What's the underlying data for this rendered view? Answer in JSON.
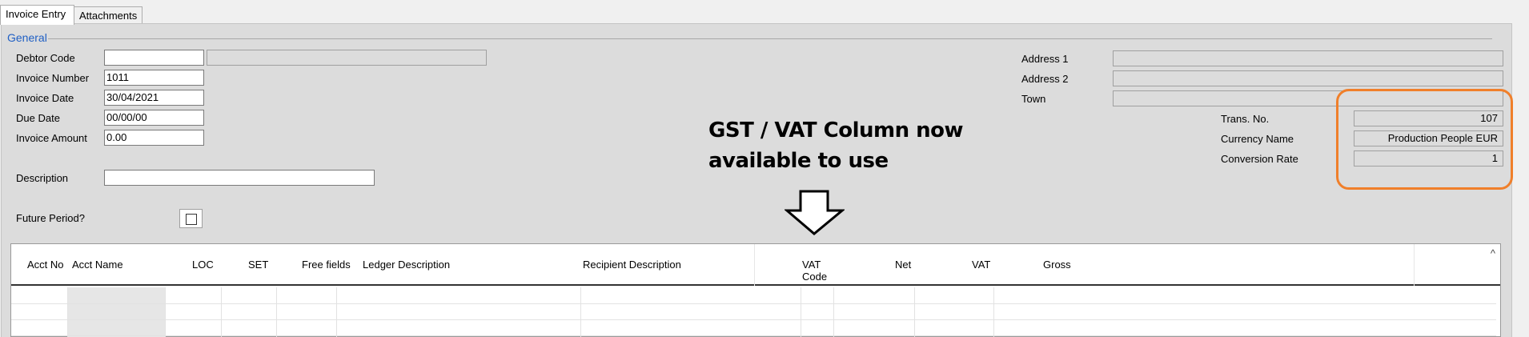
{
  "tabs": [
    {
      "label": "Invoice Entry",
      "active": true
    },
    {
      "label": "Attachments",
      "active": false
    }
  ],
  "group": {
    "label": "General"
  },
  "fields": {
    "debtor_code": {
      "label": "Debtor Code",
      "value": ""
    },
    "invoice_number": {
      "label": "Invoice Number",
      "value": "1011"
    },
    "invoice_date": {
      "label": "Invoice Date",
      "value": "30/04/2021"
    },
    "due_date": {
      "label": "Due Date",
      "value": "00/00/00"
    },
    "invoice_amount": {
      "label": "Invoice Amount",
      "value": "0.00"
    },
    "description": {
      "label": "Description",
      "value": ""
    },
    "future_period": {
      "label": "Future Period?",
      "checked": false
    }
  },
  "address": {
    "address1": {
      "label": "Address 1",
      "value": ""
    },
    "address2": {
      "label": "Address 2",
      "value": ""
    },
    "town": {
      "label": "Town",
      "value": ""
    }
  },
  "currency": {
    "trans_no": {
      "label": "Trans. No.",
      "value": "107"
    },
    "currency_name": {
      "label": "Currency Name",
      "value": "Production People EUR"
    },
    "conversion_rate": {
      "label": "Conversion Rate",
      "value": "1"
    }
  },
  "callout": {
    "line1": "GST / VAT Column now",
    "line2": "available to use",
    "arrow_icon": "down-arrow-outline",
    "highlight_color": "#f07f2a"
  },
  "grid": {
    "columns": [
      "Acct No",
      "Acct Name",
      "LOC",
      "SET",
      "Free fields",
      "Ledger Description",
      "Recipient Description",
      "VAT Code",
      "Net",
      "VAT",
      "Gross"
    ],
    "vat_code_line1": "VAT",
    "vat_code_line2": "Code",
    "scroll_up_icon": "^"
  }
}
